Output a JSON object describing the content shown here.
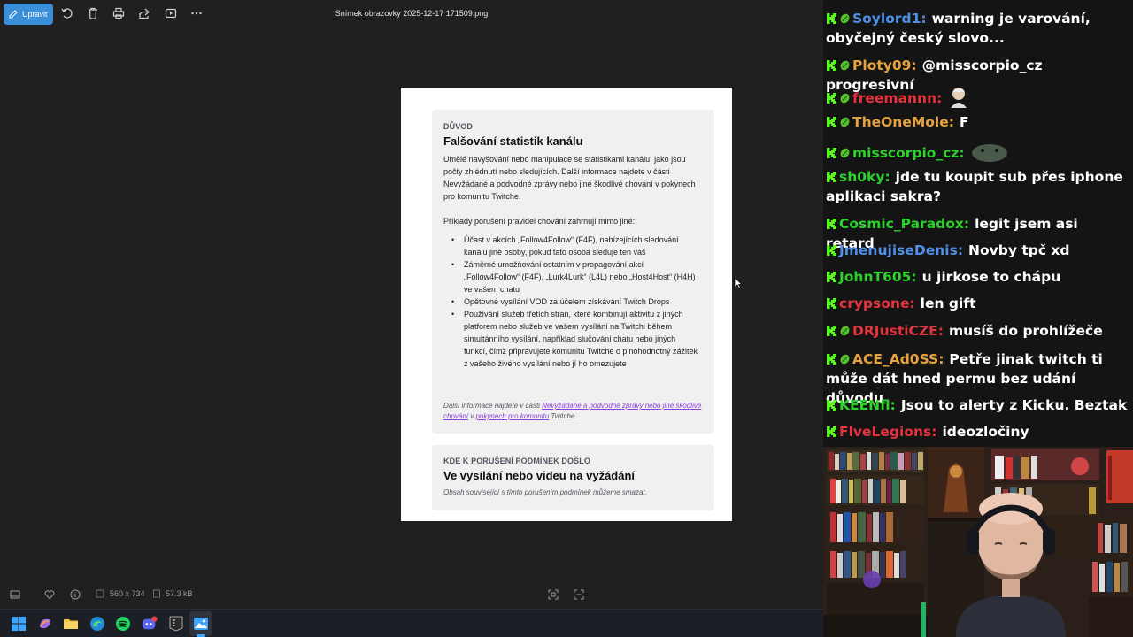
{
  "viewer": {
    "edit_label": "Upravit",
    "file_title": "Snímek obrazovky 2025-12-17 171509.png",
    "dimensions": "560 x 734",
    "file_size": "57.3 kB",
    "toolbar_icons": [
      "rotate-icon",
      "delete-icon",
      "print-icon",
      "share-icon",
      "slideshow-icon",
      "more-icon"
    ]
  },
  "document": {
    "card1": {
      "eyebrow": "DŮVOD",
      "heading": "Falšování statistik kanálu",
      "para1": "Umělé navyšování nebo manipulace se statistikami kanálu, jako jsou počty zhlédnutí nebo sledujících. Další informace najdete v části Nevyžádané a podvodné zprávy nebo jiné škodlivé chování v pokynech pro komunitu Twitche.",
      "para2": "Příklady porušení pravidel chování zahrnují mimo jiné:",
      "bullets": [
        "Účast v akcích „Follow4Follow“ (F4F), nabízejících sledování kanálu jiné osoby, pokud tato osoba sleduje ten váš",
        "Záměrné umožňování ostatním v propagování akcí „Follow4Follow“ (F4F), „Lurk4Lurk“ (L4L) nebo „Host4Host“ (H4H) ve vašem chatu",
        "Opětovné vysílání VOD za účelem získávání Twitch Drops",
        "Používání služeb třetích stran, které kombinují aktivitu z jiných platforem nebo služeb ve vašem vysílání na Twitchi během simultánního vysílání, například slučování chatu nebo jiných funkcí, čímž připravujete komunitu Twitche o plnohodnotný zážitek z vašeho živého vysílání nebo jí ho omezujete"
      ],
      "note_prefix": "Další informace najdete v části ",
      "note_link1": "Nevyžádané a podvodné zprávy nebo jiné škodlivé chování",
      "note_mid": " v ",
      "note_link2": "pokynech pro komunitu",
      "note_suffix": " Twitche."
    },
    "card2": {
      "eyebrow": "KDE K PORUŠENÍ PODMÍNEK DOŠLO",
      "heading": "Ve vysílání nebo videu na vyžádání",
      "note": "Obsah související s tímto porušením podmínek můžeme smazat."
    }
  },
  "chat": [
    {
      "user": "Soylord1:",
      "color": "#4f8fe6",
      "text": "warning je varování, obyčejný český slovo..."
    },
    {
      "user": "Ploty09:",
      "color": "#e6a23c",
      "text": "@misscorpio_cz progresivní"
    },
    {
      "user": "freemannn:",
      "color": "#e6323c",
      "text": ""
    },
    {
      "user": "TheOneMole:",
      "color": "#e6a23c",
      "text": "F"
    },
    {
      "user": "misscorpio_cz:",
      "color": "#2cd12c",
      "text": ""
    },
    {
      "user": "sh0ky:",
      "color": "#2cd12c",
      "text": "jde tu koupit sub přes iphone aplikaci sakra?"
    },
    {
      "user": "Cosmic_Paradox:",
      "color": "#2cd12c",
      "text": "legit jsem asi retard"
    },
    {
      "user": "JmenujiseDenis:",
      "color": "#4f8fe6",
      "text": "Novby tpč xd"
    },
    {
      "user": "JohnT605:",
      "color": "#2cd12c",
      "text": "u jirkose to chápu"
    },
    {
      "user": "crypsone:",
      "color": "#e6323c",
      "text": "len gift"
    },
    {
      "user": "DRJustiCZE:",
      "color": "#e6323c",
      "text": "musíš do prohlížeče"
    },
    {
      "user": "ACE_Ad0SS:",
      "color": "#e6a23c",
      "text": "Petře jinak twitch ti může dát hned permu bez udání důvodu"
    },
    {
      "user": "KEENfl:",
      "color": "#2cd12c",
      "text": "Jsou to alerty z Kicku. Beztak"
    },
    {
      "user": "FlveLegions:",
      "color": "#e6323c",
      "text": "ideozločiny"
    }
  ]
}
